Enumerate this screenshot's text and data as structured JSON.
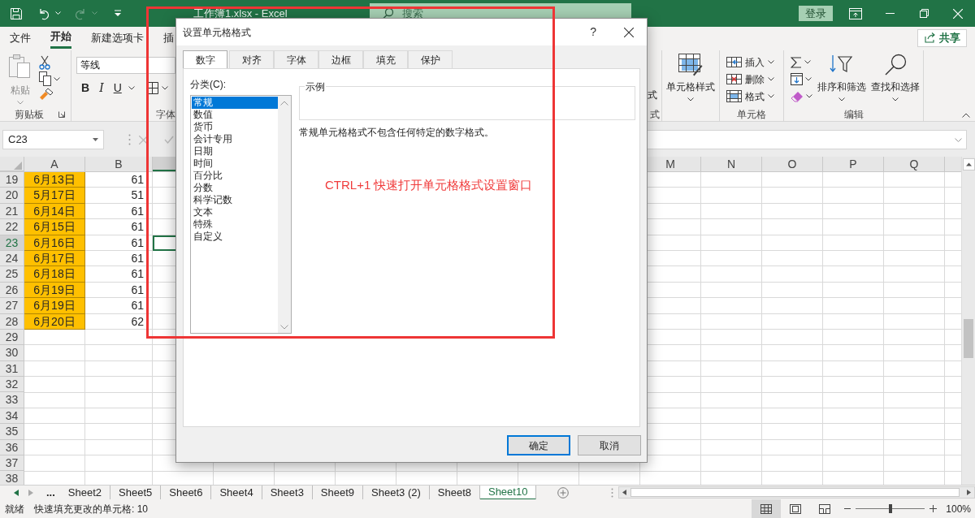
{
  "title_bar": {
    "title": "工作簿1.xlsx  -  Excel",
    "search": {
      "placeholder": "搜索"
    },
    "sign_in": "登录"
  },
  "ribbon_tabs": [
    {
      "label": "文件",
      "selected": false
    },
    {
      "label": "开始",
      "selected": true
    },
    {
      "label": "新建选项卡",
      "selected": false
    },
    {
      "label": "插",
      "selected": false
    }
  ],
  "share": "共享",
  "ribbon": {
    "clipboard": {
      "paste": {
        "label": "粘贴",
        "disabled": true
      },
      "label": "剪贴板"
    },
    "font": {
      "font_name": "等线",
      "bold": "B",
      "italic": "I",
      "underline": "U",
      "label": "字体"
    },
    "styles_partial": {
      "button": "式",
      "label": "式"
    },
    "cell_styles": "单元格样式",
    "cells": {
      "buttons": [
        {
          "label": "插入",
          "kind": "insert"
        },
        {
          "label": "删除",
          "kind": "delete"
        },
        {
          "label": "格式",
          "kind": "format"
        }
      ],
      "label": "单元格"
    },
    "editing": {
      "sort_filter": "排序和筛选",
      "find_select": "查找和选择",
      "label": "编辑"
    }
  },
  "formula_bar": {
    "name_box": "C23"
  },
  "sheet": {
    "columns_left": [
      "A",
      "B"
    ],
    "middle_columns": [
      {
        "selected": true
      }
    ],
    "columns_right": [
      "M",
      "N",
      "O",
      "P",
      "Q"
    ],
    "rows": [
      {
        "number": "19",
        "a": "6月13日",
        "b": "61",
        "filled": true,
        "selected": false
      },
      {
        "number": "20",
        "a": "5月17日",
        "b": "51",
        "filled": true,
        "selected": false
      },
      {
        "number": "21",
        "a": "6月14日",
        "b": "61",
        "filled": true,
        "selected": false
      },
      {
        "number": "22",
        "a": "6月15日",
        "b": "61",
        "filled": true,
        "selected": false
      },
      {
        "number": "23",
        "a": "6月16日",
        "b": "61",
        "filled": true,
        "selected": true
      },
      {
        "number": "24",
        "a": "6月17日",
        "b": "61",
        "filled": true,
        "selected": false
      },
      {
        "number": "25",
        "a": "6月18日",
        "b": "61",
        "filled": true,
        "selected": false
      },
      {
        "number": "26",
        "a": "6月19日",
        "b": "61",
        "filled": true,
        "selected": false
      },
      {
        "number": "27",
        "a": "6月19日",
        "b": "61",
        "filled": true,
        "selected": false
      },
      {
        "number": "28",
        "a": "6月20日",
        "b": "62",
        "filled": true,
        "selected": false
      },
      {
        "number": "29",
        "filled": false,
        "selected": false
      },
      {
        "number": "30",
        "filled": false,
        "selected": false
      },
      {
        "number": "31",
        "filled": false,
        "selected": false
      },
      {
        "number": "32",
        "filled": false,
        "selected": false
      },
      {
        "number": "33",
        "filled": false,
        "selected": false
      },
      {
        "number": "34",
        "filled": false,
        "selected": false
      },
      {
        "number": "35",
        "filled": false,
        "selected": false
      },
      {
        "number": "36",
        "filled": false,
        "selected": false
      },
      {
        "number": "37",
        "filled": false,
        "selected": false
      },
      {
        "number": "38",
        "filled": false,
        "selected": false
      }
    ]
  },
  "sheet_tabs": {
    "overflow": "...",
    "tabs": [
      {
        "label": "Sheet2",
        "selected": false
      },
      {
        "label": "Sheet5",
        "selected": false
      },
      {
        "label": "Sheet6",
        "selected": false
      },
      {
        "label": "Sheet4",
        "selected": false
      },
      {
        "label": "Sheet3",
        "selected": false
      },
      {
        "label": "Sheet9",
        "selected": false
      },
      {
        "label": "Sheet3 (2)",
        "selected": false
      },
      {
        "label": "Sheet8",
        "selected": false
      },
      {
        "label": "Sheet10",
        "selected": true
      }
    ]
  },
  "status_bar": {
    "mode": "就绪",
    "message": "快速填充更改的单元格: 10",
    "views": [
      {
        "kind": "normal",
        "selected": true
      },
      {
        "kind": "page_layout",
        "selected": false
      },
      {
        "kind": "page_break",
        "selected": false
      }
    ],
    "zoom": {
      "level": 0.5,
      "reading": "100%"
    }
  },
  "dialog": {
    "title": "设置单元格格式",
    "help": "?",
    "tabs": [
      {
        "label": "数字",
        "selected": true
      },
      {
        "label": "对齐",
        "selected": false
      },
      {
        "label": "字体",
        "selected": false
      },
      {
        "label": "边框",
        "selected": false
      },
      {
        "label": "填充",
        "selected": false
      },
      {
        "label": "保护",
        "selected": false
      }
    ],
    "category_label": "分类(C):",
    "categories": [
      {
        "label": "常规",
        "selected": true
      },
      {
        "label": "数值",
        "selected": false
      },
      {
        "label": "货币",
        "selected": false
      },
      {
        "label": "会计专用",
        "selected": false
      },
      {
        "label": "日期",
        "selected": false
      },
      {
        "label": "时间",
        "selected": false
      },
      {
        "label": "百分比",
        "selected": false
      },
      {
        "label": "分数",
        "selected": false
      },
      {
        "label": "科学记数",
        "selected": false
      },
      {
        "label": "文本",
        "selected": false
      },
      {
        "label": "特殊",
        "selected": false
      },
      {
        "label": "自定义",
        "selected": false
      }
    ],
    "sample_label": "示例",
    "description": "常规单元格格式不包含任何特定的数字格式。",
    "buttons": [
      {
        "label": "确定",
        "kind": "primary"
      },
      {
        "label": "取消",
        "kind": "secondary"
      }
    ]
  },
  "annotation": {
    "text": "CTRL+1 快速打开单元格格式设置窗口"
  }
}
